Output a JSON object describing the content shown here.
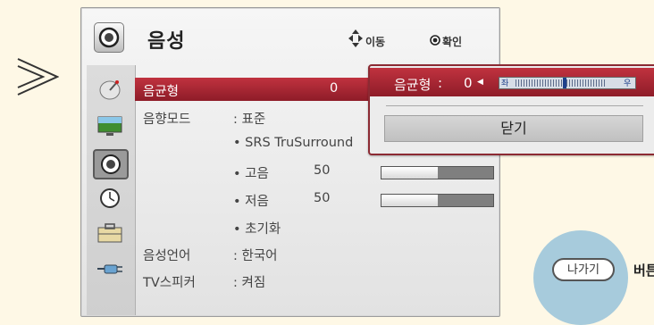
{
  "header": {
    "title": "음성",
    "nav_hint": "이동",
    "ok_hint": "확인"
  },
  "sidebar": {
    "items": [
      {
        "icon": "satellite-dish-icon",
        "selected": false
      },
      {
        "icon": "tv-screen-icon",
        "selected": false
      },
      {
        "icon": "speaker-icon",
        "selected": true
      },
      {
        "icon": "clock-icon",
        "selected": false
      },
      {
        "icon": "toolbox-icon",
        "selected": false
      },
      {
        "icon": "plug-icon",
        "selected": false
      }
    ]
  },
  "menu": {
    "rows": [
      {
        "label": "음균형",
        "value": "0",
        "selected": true
      },
      {
        "label": "음향모드",
        "value": ": 표준"
      },
      {
        "sub": "• SRS TruSurround"
      },
      {
        "sub": "• 고음",
        "value": "50",
        "level": 0.5
      },
      {
        "sub": "• 저음",
        "value": "50",
        "level": 0.5
      },
      {
        "sub": "• 초기화"
      },
      {
        "label": "음성언어",
        "value": ": 한국어"
      },
      {
        "label": "TV스피커",
        "value": ": 켜짐"
      }
    ]
  },
  "popup": {
    "label": "음균형",
    "separator": ":",
    "value": "0",
    "left_marker": "좌",
    "right_marker": "우",
    "balance": 0,
    "close_label": "닫기"
  },
  "callout": {
    "button_label": "나가기",
    "text": "버튼"
  },
  "colors": {
    "selected_row": "#b52a37",
    "background": "#fef8e6",
    "callout": "#a7cbdc"
  }
}
